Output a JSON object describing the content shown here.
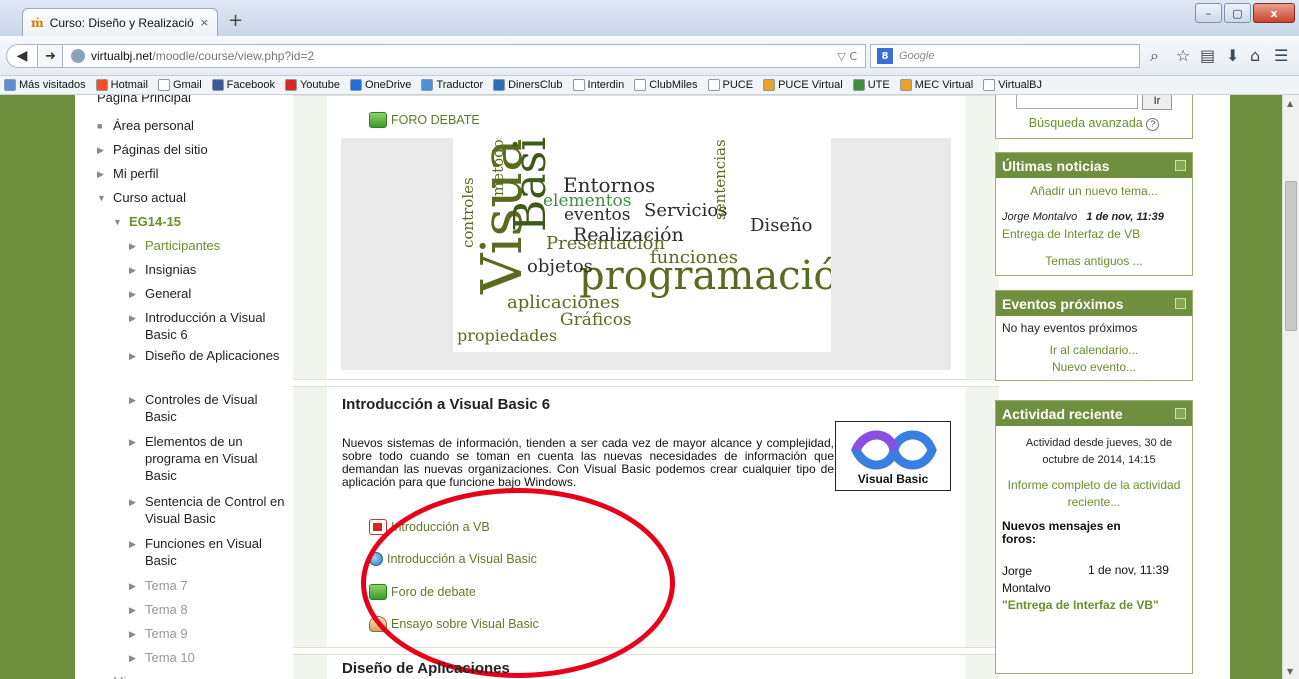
{
  "browser": {
    "tab_title": "Curso: Diseño y Realizació...",
    "tab_close": "×",
    "new_tab": "+",
    "url_host": "virtualbj.net",
    "url_path": "/moodle/course/view.php?id=2",
    "url_ctl": "▽ C",
    "search_placeholder": "Google",
    "search_engine": "8",
    "window_min": "–",
    "window_max": "▢",
    "window_close": "x",
    "back": "◀",
    "forward": "➜",
    "icons": [
      "search-icon",
      "star-icon",
      "reading-list-icon",
      "download-icon",
      "home-icon",
      "menu-icon"
    ]
  },
  "bookmarks": [
    {
      "label": "Más visitados",
      "color": "#5b8fd0"
    },
    {
      "label": "Hotmail",
      "color": "#f25022"
    },
    {
      "label": "Gmail",
      "color": "#ffffff"
    },
    {
      "label": "Facebook",
      "color": "#3b5998"
    },
    {
      "label": "Youtube",
      "color": "#d62a1f"
    },
    {
      "label": "OneDrive",
      "color": "#1e6fd9"
    },
    {
      "label": "Traductor",
      "color": "#4a90d9"
    },
    {
      "label": "DinersClub",
      "color": "#2a6fb8"
    },
    {
      "label": "Interdin",
      "color": "#ffffff"
    },
    {
      "label": "ClubMiles",
      "color": "#ffffff"
    },
    {
      "label": "PUCE",
      "color": "#ffffff"
    },
    {
      "label": "PUCE Virtual",
      "color": "#e8a22a"
    },
    {
      "label": "UTE",
      "color": "#3d8f3d"
    },
    {
      "label": "MEC Virtual",
      "color": "#e8a22a"
    },
    {
      "label": "VirtualBJ",
      "color": "#ffffff"
    }
  ],
  "nav": {
    "items": [
      {
        "label": "Página Principal",
        "marker": "",
        "style": "normal"
      },
      {
        "label": "Área personal",
        "marker": "■",
        "style": "normal"
      },
      {
        "label": "Páginas del sitio",
        "marker": "▶",
        "style": "normal"
      },
      {
        "label": "Mi perfil",
        "marker": "▶",
        "style": "normal"
      },
      {
        "label": "Curso actual",
        "marker": "▼",
        "style": "normal"
      },
      {
        "label": "EG14-15",
        "marker": "▼",
        "style": "green-bold"
      },
      {
        "label": "Participantes",
        "marker": "▶",
        "style": "green"
      },
      {
        "label": "Insignias",
        "marker": "▶",
        "style": "normal"
      },
      {
        "label": "General",
        "marker": "▶",
        "style": "normal"
      },
      {
        "label": "Introducción a Visual Basic 6",
        "marker": "▶",
        "style": "normal"
      },
      {
        "label": "Diseño de Aplicaciones",
        "marker": "▶",
        "style": "normal"
      },
      {
        "label": "Controles de Visual Basic",
        "marker": "▶",
        "style": "normal"
      },
      {
        "label": "Elementos de un programa en Visual Basic",
        "marker": "▶",
        "style": "normal"
      },
      {
        "label": "Sentencia de Control en Visual Basic",
        "marker": "▶",
        "style": "normal"
      },
      {
        "label": "Funciones en Visual Basic",
        "marker": "▶",
        "style": "normal"
      },
      {
        "label": "Tema 7",
        "marker": "▶",
        "style": "dim"
      },
      {
        "label": "Tema 8",
        "marker": "▶",
        "style": "dim"
      },
      {
        "label": "Tema 9",
        "marker": "▶",
        "style": "dim"
      },
      {
        "label": "Tema 10",
        "marker": "▶",
        "style": "dim"
      },
      {
        "label": "Mi...",
        "marker": "▶",
        "style": "dim"
      }
    ]
  },
  "general": {
    "forum_label": "FORO DEBATE",
    "wordcloud": [
      "Visual",
      "Basic",
      "programación",
      "metodos",
      "controles",
      "elementos",
      "Entornos",
      "eventos",
      "Servicios",
      "Realización",
      "Presentación",
      "funciones",
      "sentencias",
      "Diseño",
      "objetos",
      "aplicaciones",
      "Gráficos",
      "propiedades"
    ]
  },
  "section1": {
    "title": "Introducción a Visual Basic 6",
    "summary": "Nuevos sistemas de información, tienden a ser cada vez de mayor alcance y complejidad, sobre todo cuando se toman en cuenta las nuevas necesidades de información que demandan las nuevas organizaciones. Con Visual Basic podemos crear cualquier tipo de aplicación para que funcione bajo Windows.",
    "logo_label": "Visual Basic",
    "activities": [
      {
        "label": "Introducción a VB",
        "icon": "pdf-icon"
      },
      {
        "label": "Introducción a Visual Basic",
        "icon": "url-icon"
      },
      {
        "label": "Foro de debate",
        "icon": "forum-icon"
      },
      {
        "label": "Ensayo sobre Visual Basic",
        "icon": "assignment-icon"
      }
    ]
  },
  "section2": {
    "title": "Diseño de Aplicaciones"
  },
  "search_block": {
    "button": "Ir",
    "advanced": "Búsqueda avanzada",
    "help": "?"
  },
  "news_block": {
    "title": "Últimas noticias",
    "add": "Añadir un nuevo tema...",
    "author": "Jorge Montalvo",
    "date": "1 de nov, 11:39",
    "post": "Entrega de Interfaz de VB",
    "older": "Temas antiguos ..."
  },
  "events_block": {
    "title": "Eventos próximos",
    "none": "No hay eventos próximos",
    "calendar": "Ir al calendario...",
    "new_event": "Nuevo evento..."
  },
  "activity_block": {
    "title": "Actividad reciente",
    "since": "Actividad desde jueves, 30 de octubre de 2014, 14:15",
    "full_report": "Informe completo de la actividad reciente...",
    "new_posts": "Nuevos mensajes en foros:",
    "post_author": "Jorge Montalvo",
    "post_date": "1 de nov, 11:39",
    "post_title": "\"Entrega de Interfaz de VB\""
  },
  "annotation": {
    "color": "#e8001a"
  }
}
